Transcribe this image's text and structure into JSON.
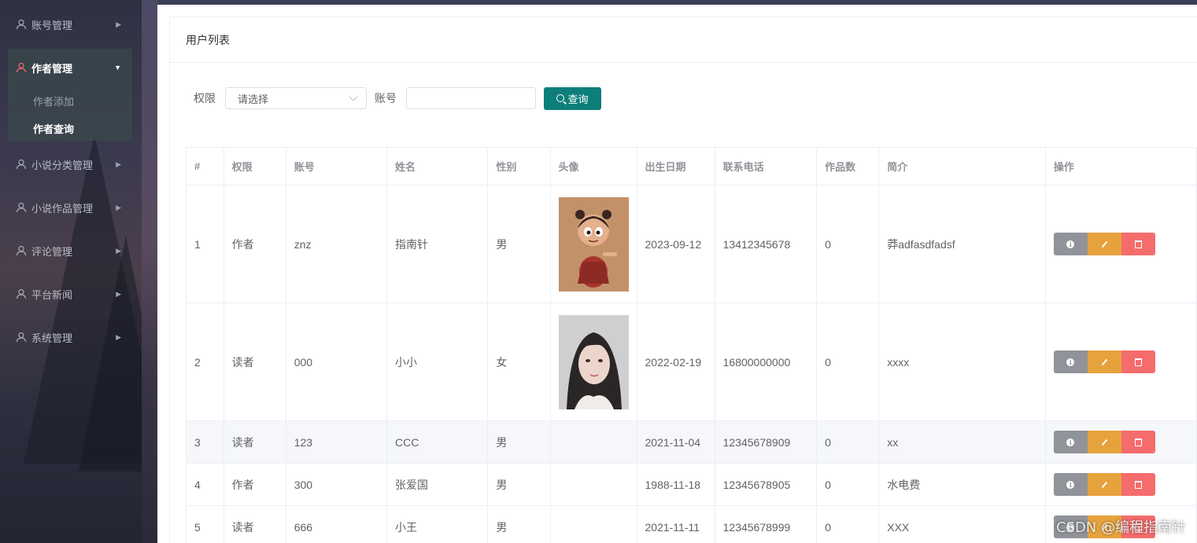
{
  "sidebar": {
    "items": [
      {
        "label": "账号管理",
        "icon": "user-icon"
      },
      {
        "label": "作者管理",
        "icon": "user-icon",
        "open": true
      },
      {
        "label": "小说分类管理",
        "icon": "user-icon"
      },
      {
        "label": "小说作品管理",
        "icon": "user-icon"
      },
      {
        "label": "评论管理",
        "icon": "user-icon"
      },
      {
        "label": "平台新闻",
        "icon": "user-icon"
      },
      {
        "label": "系统管理",
        "icon": "user-icon"
      }
    ],
    "submenu": [
      {
        "label": "作者添加"
      },
      {
        "label": "作者查询",
        "active": true
      }
    ]
  },
  "panel": {
    "title": "用户列表"
  },
  "search": {
    "permission_label": "权限",
    "permission_placeholder": "请选择",
    "account_label": "账号",
    "account_value": "",
    "query_button": "查询"
  },
  "table": {
    "headers": [
      "#",
      "权限",
      "账号",
      "姓名",
      "性别",
      "头像",
      "出生日期",
      "联系电话",
      "作品数",
      "简介",
      "操作"
    ],
    "rows": [
      {
        "no": "1",
        "role": "作者",
        "account": "znz",
        "name": "指南针",
        "gender": "男",
        "avatar": "cartoon-girl",
        "birth": "2023-09-12",
        "phone": "13412345678",
        "works": "0",
        "intro": "莽adfasdfadsf"
      },
      {
        "no": "2",
        "role": "读者",
        "account": "000",
        "name": "小小",
        "gender": "女",
        "avatar": "portrait-girl",
        "birth": "2022-02-19",
        "phone": "16800000000",
        "works": "0",
        "intro": "xxxx"
      },
      {
        "no": "3",
        "role": "读者",
        "account": "123",
        "name": "CCC",
        "gender": "男",
        "avatar": "",
        "birth": "2021-11-04",
        "phone": "12345678909",
        "works": "0",
        "intro": "xx"
      },
      {
        "no": "4",
        "role": "作者",
        "account": "300",
        "name": "张爱国",
        "gender": "男",
        "avatar": "",
        "birth": "1988-11-18",
        "phone": "12345678905",
        "works": "0",
        "intro": "水电费"
      },
      {
        "no": "5",
        "role": "读者",
        "account": "666",
        "name": "小王",
        "gender": "男",
        "avatar": "",
        "birth": "2021-11-11",
        "phone": "12345678999",
        "works": "0",
        "intro": "XXX"
      }
    ]
  },
  "colors": {
    "query_button": "#0d7f7a",
    "info": "#909399",
    "edit": "#e6a23c",
    "delete": "#f56c6c"
  },
  "watermark": "CSDN @编程指南针"
}
